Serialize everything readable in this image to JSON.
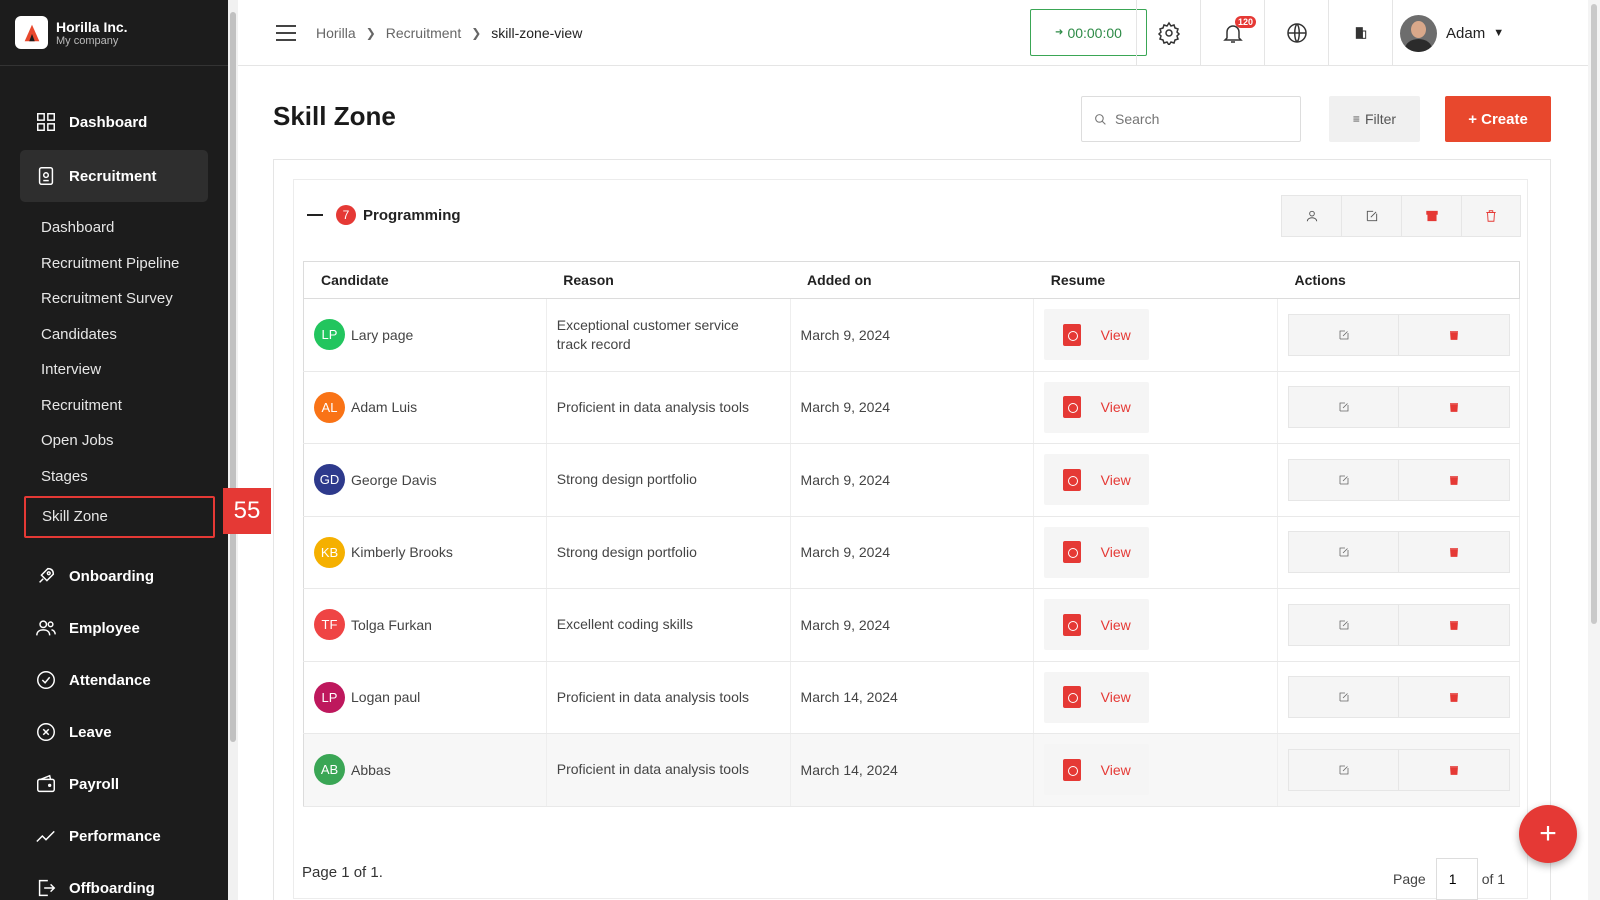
{
  "brand": {
    "name": "Horilla Inc.",
    "sub": "My company"
  },
  "sidebar": {
    "main_top": [
      {
        "label": "Dashboard",
        "icon": "grid-icon"
      },
      {
        "label": "Recruitment",
        "icon": "id-card-icon"
      }
    ],
    "sub_items": [
      "Dashboard",
      "Recruitment Pipeline",
      "Recruitment Survey",
      "Candidates",
      "Interview",
      "Recruitment",
      "Open Jobs",
      "Stages",
      "Skill Zone"
    ],
    "main_bottom": [
      {
        "label": "Onboarding",
        "icon": "rocket-icon"
      },
      {
        "label": "Employee",
        "icon": "users-icon"
      },
      {
        "label": "Attendance",
        "icon": "check-circle-icon"
      },
      {
        "label": "Leave",
        "icon": "x-circle-icon"
      },
      {
        "label": "Payroll",
        "icon": "wallet-icon"
      },
      {
        "label": "Performance",
        "icon": "trend-icon"
      },
      {
        "label": "Offboarding",
        "icon": "exit-icon"
      }
    ],
    "annotation_badge": "55"
  },
  "topbar": {
    "breadcrumb": [
      "Horilla",
      "Recruitment",
      "skill-zone-view"
    ],
    "timer": "00:00:00",
    "notifications": "120",
    "user": "Adam"
  },
  "page": {
    "title": "Skill Zone",
    "search_placeholder": "Search",
    "filter_label": "Filter",
    "create_label": "+ Create"
  },
  "group": {
    "count": "7",
    "title": "Programming"
  },
  "table": {
    "headers": [
      "Candidate",
      "Reason",
      "Added on",
      "Resume",
      "Actions"
    ],
    "view_label": "View",
    "rows": [
      {
        "initials": "LP",
        "name": "Lary page",
        "color": "#22c55e",
        "reason": "Exceptional customer service track record",
        "date": "March 9, 2024"
      },
      {
        "initials": "AL",
        "name": "Adam Luis",
        "color": "#f97316",
        "reason": "Proficient in data analysis tools",
        "date": "March 9, 2024"
      },
      {
        "initials": "GD",
        "name": "George Davis",
        "color": "#2e3a8c",
        "reason": "Strong design portfolio",
        "date": "March 9, 2024"
      },
      {
        "initials": "KB",
        "name": "Kimberly Brooks",
        "color": "#f5b000",
        "reason": "Strong design portfolio",
        "date": "March 9, 2024"
      },
      {
        "initials": "TF",
        "name": "Tolga Furkan",
        "color": "#ef4444",
        "reason": "Excellent coding skills",
        "date": "March 9, 2024"
      },
      {
        "initials": "LP",
        "name": "Logan paul",
        "color": "#be185d",
        "reason": "Proficient in data analysis tools",
        "date": "March 14, 2024"
      },
      {
        "initials": "AB",
        "name": "Abbas",
        "color": "#3aa655",
        "reason": "Proficient in data analysis tools",
        "date": "March 14, 2024"
      }
    ]
  },
  "footer": {
    "page_info": "Page 1 of 1.",
    "page_label": "Page",
    "page_value": "1",
    "of_label": "of 1"
  },
  "fab_label": "+"
}
